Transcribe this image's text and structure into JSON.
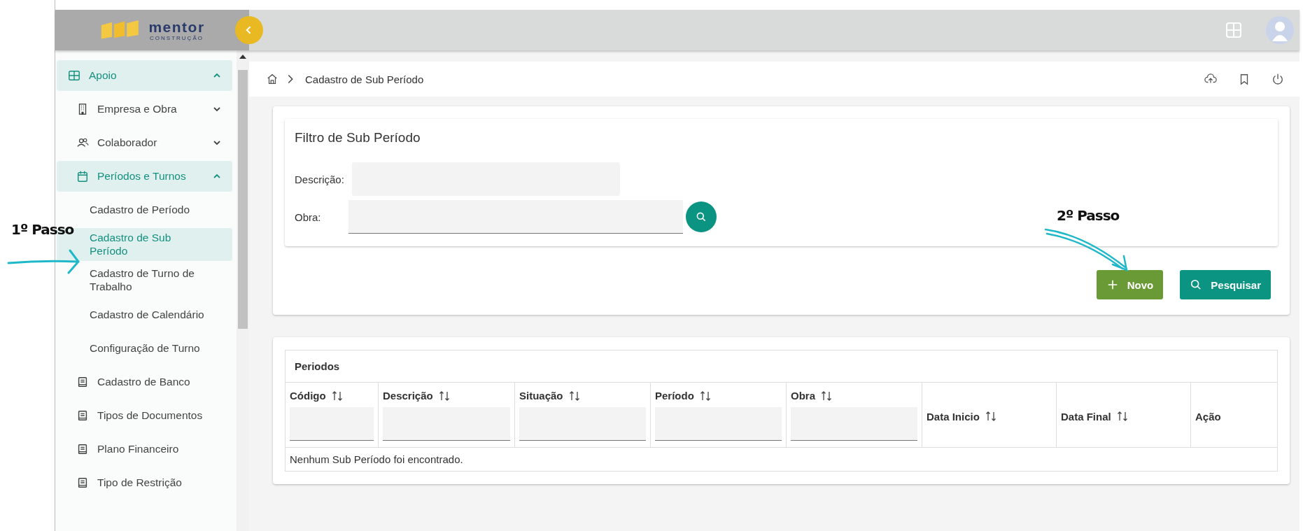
{
  "logo": {
    "name": "mentor",
    "tagline": "CONSTRUÇÃO"
  },
  "sidebar": {
    "items": [
      {
        "label": "Apoio",
        "expanded": true,
        "children": [
          {
            "label": "Empresa e Obra",
            "expanded": false
          },
          {
            "label": "Colaborador",
            "expanded": false
          },
          {
            "label": "Períodos e Turnos",
            "expanded": true,
            "children": [
              {
                "label": "Cadastro de Período",
                "selected": false
              },
              {
                "label": "Cadastro de Sub Período",
                "selected": true
              },
              {
                "label": "Cadastro de Turno de Trabalho",
                "selected": false
              },
              {
                "label": "Cadastro de Calendário",
                "selected": false
              },
              {
                "label": "Configuração de Turno",
                "selected": false
              }
            ]
          },
          {
            "label": "Cadastro de Banco",
            "selected": false
          },
          {
            "label": "Tipos de Documentos",
            "selected": false
          },
          {
            "label": "Plano Financeiro",
            "selected": false
          },
          {
            "label": "Tipo de Restrição",
            "selected": false
          }
        ]
      }
    ]
  },
  "breadcrumb": [
    "Cadastro de Sub Período"
  ],
  "filter": {
    "title": "Filtro de Sub Período",
    "fields": [
      {
        "label": "Descrição:",
        "kind": "text"
      },
      {
        "label": "Obra:",
        "kind": "lookup"
      }
    ]
  },
  "buttons": [
    {
      "label": "Novo",
      "kind": "add"
    },
    {
      "label": "Pesquisar",
      "kind": "search"
    }
  ],
  "table": {
    "title": "Periodos",
    "columns": [
      {
        "label": "Código",
        "filter": true
      },
      {
        "label": "Descrição",
        "filter": true
      },
      {
        "label": "Situação",
        "filter": true
      },
      {
        "label": "Período",
        "filter": true
      },
      {
        "label": "Obra",
        "filter": true
      },
      {
        "label": "Data Inicio",
        "filter": false
      },
      {
        "label": "Data Final",
        "filter": false
      },
      {
        "label": "Ação",
        "filter": false,
        "kind": "action"
      }
    ],
    "empty_message": "Nenhum Sub Período foi encontrado."
  },
  "annotations": [
    {
      "text": "1º Passo"
    },
    {
      "text": "2º Passo"
    }
  ]
}
